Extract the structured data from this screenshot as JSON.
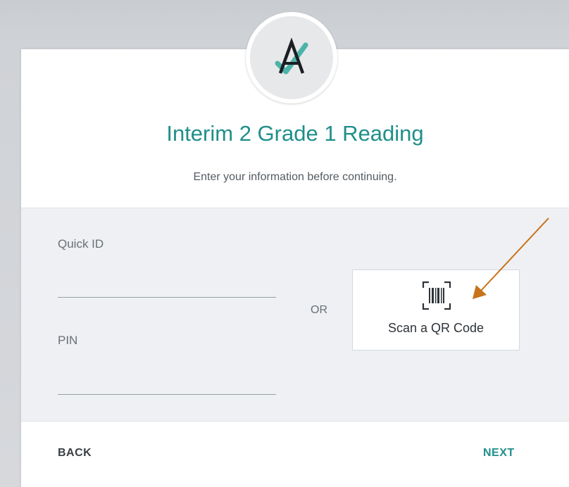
{
  "header": {
    "logo_letter": "A",
    "title": "Interim 2 Grade 1 Reading",
    "subtitle": "Enter your information before continuing."
  },
  "form": {
    "quick_id_label": "Quick ID",
    "quick_id_value": "",
    "pin_label": "PIN",
    "pin_value": "",
    "or_text": "OR",
    "scan_button_label": "Scan a QR Code",
    "scan_icon": "barcode-scan-icon"
  },
  "footer": {
    "back_label": "BACK",
    "next_label": "NEXT"
  },
  "annotation": {
    "icon": "arrow-annotation-icon",
    "color": "#c8721a"
  },
  "colors": {
    "accent": "#1f8f8a",
    "band_background": "#eef0f3"
  }
}
